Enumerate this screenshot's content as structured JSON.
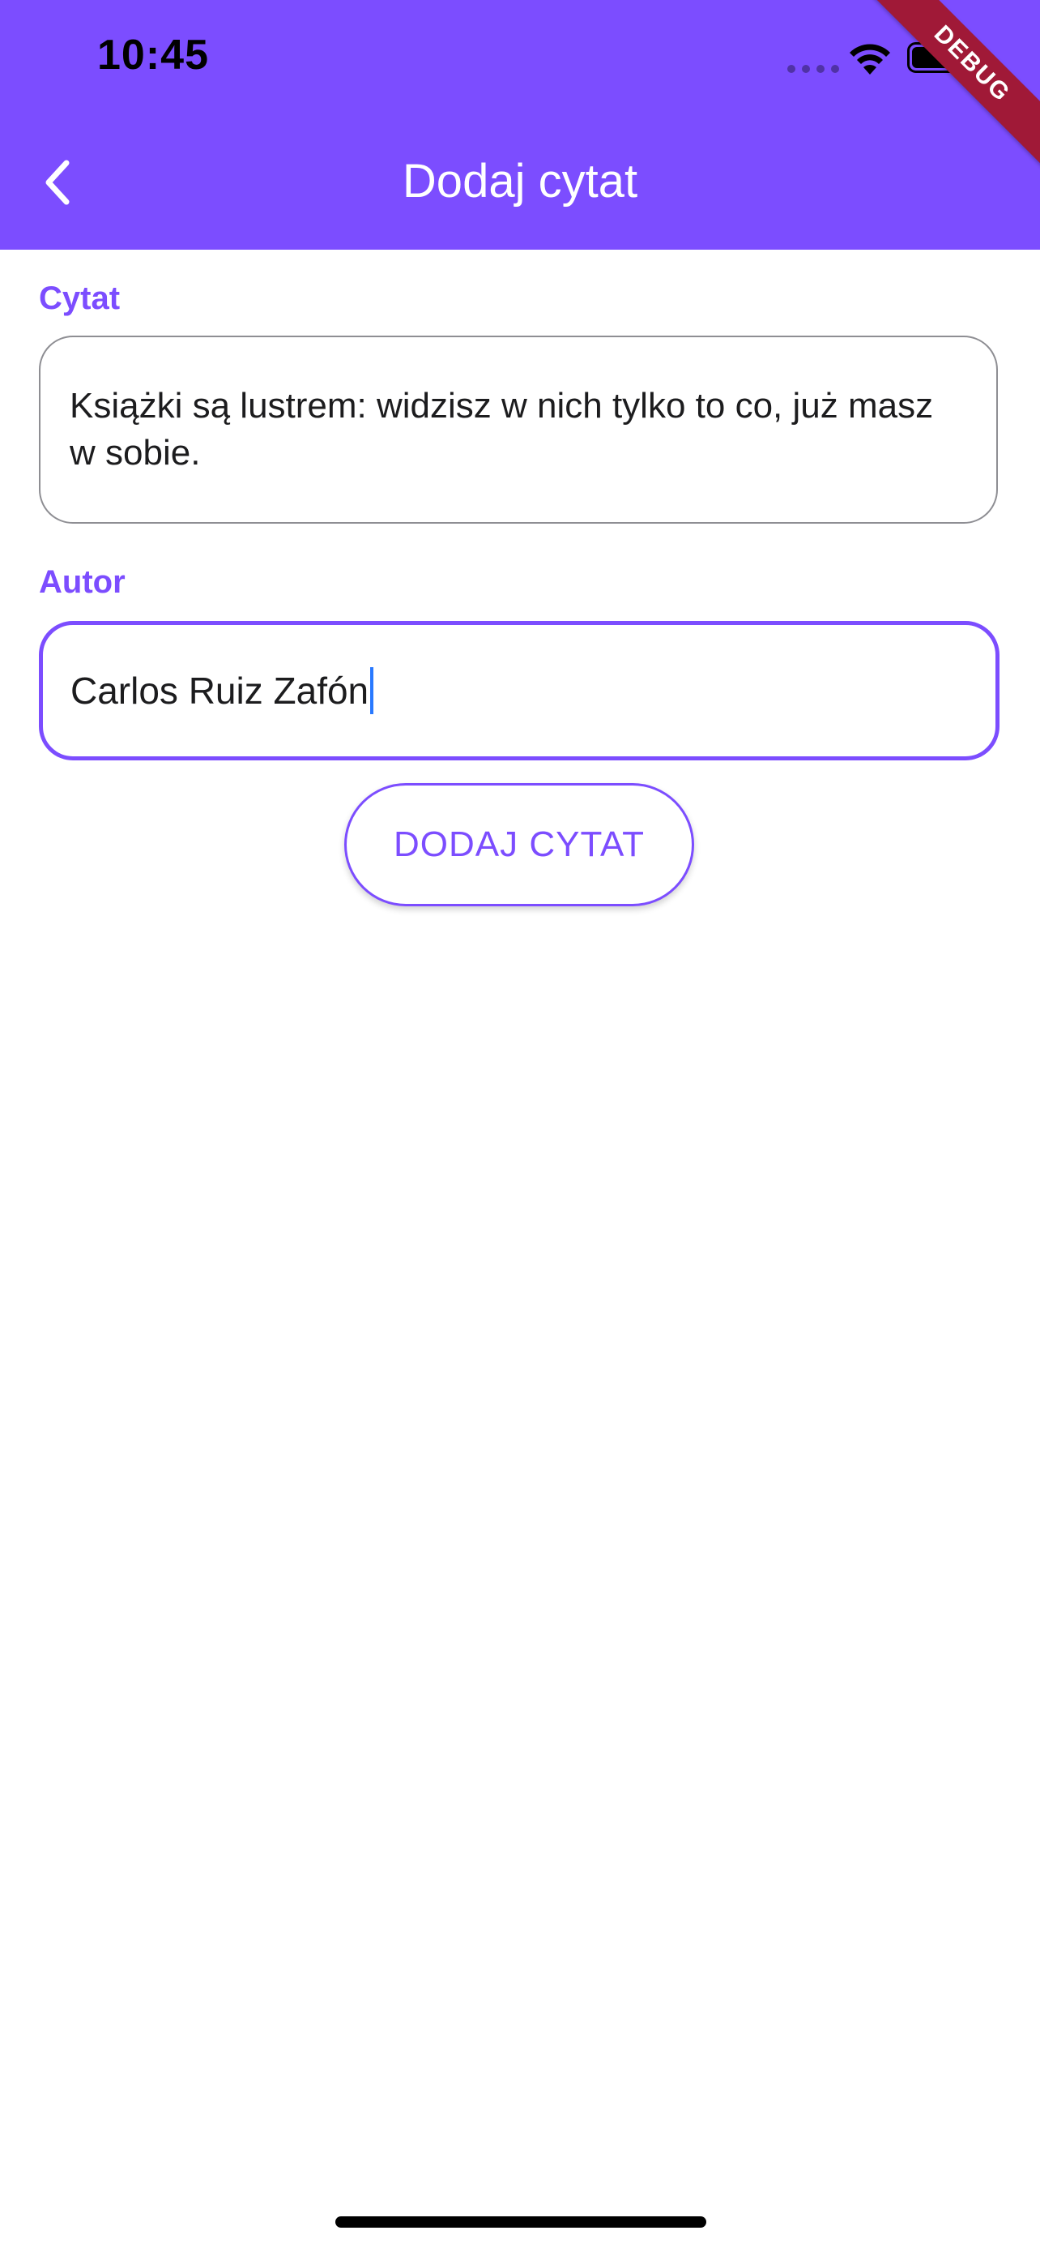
{
  "status_bar": {
    "time": "10:45"
  },
  "header": {
    "title": "Dodaj cytat",
    "back_icon": "chevron-left-icon",
    "background_color": "#7c4dff"
  },
  "debug_banner": {
    "label": "DEBUG",
    "color": "#a01937"
  },
  "form": {
    "quote_label": "Cytat",
    "quote_value": "Książki są lustrem: widzisz w nich tylko to co, już masz w sobie.",
    "author_label": "Autor",
    "author_value": "Carlos Ruiz Zafón",
    "submit_label": "DODAJ CYTAT",
    "accent_color": "#7c4dff"
  }
}
